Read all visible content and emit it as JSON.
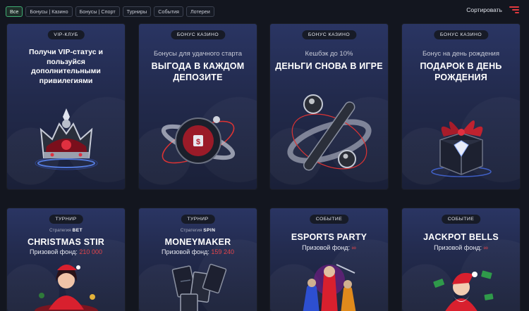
{
  "filters": [
    "Все",
    "Бонусы | Казино",
    "Бонусы | Спорт",
    "Турниры",
    "События",
    "Лотереи"
  ],
  "sort_label": "Сортировать",
  "cards": [
    {
      "badge": "VIP-КЛУБ",
      "title": "Получи VIP-статус и пользуйся дополнительными привилегиями",
      "icon": "crown-icon"
    },
    {
      "badge": "БОНУС КАЗИНО",
      "subtitle": "Бонусы для удачного старта",
      "title": "ВЫГОДА В КАЖДОМ ДЕПОЗИТЕ",
      "icon": "deposit-sphere-icon"
    },
    {
      "badge": "БОНУС КАЗИНО",
      "subtitle": "Кешбэк до 10%",
      "title": "ДЕНЬГИ СНОВА В ИГРЕ",
      "icon": "cashback-icon"
    },
    {
      "badge": "БОНУС КАЗИНО",
      "subtitle": "Бонус на день рождения",
      "title": "ПОДАРОК В ДЕНЬ РОЖДЕНИЯ",
      "icon": "gift-box-icon"
    },
    {
      "badge": "ТУРНИР",
      "strategy_label": "Стратегия",
      "strategy_value": "BET",
      "title": "CHRISTMAS STIR",
      "prize_label": "Призовой фонд:",
      "prize_value": "210 000",
      "icon": "christmas-girl-icon"
    },
    {
      "badge": "ТУРНИР",
      "strategy_label": "Стратегия",
      "strategy_value": "SPIN",
      "title": "MONEYMAKER",
      "prize_label": "Призовой фонд:",
      "prize_value": "159 240",
      "icon": "money-cards-icon"
    },
    {
      "badge": "СОБЫТИЕ",
      "title": "ESPORTS PARTY",
      "prize_label": "Призовой фонд:",
      "prize_value": "∞",
      "icon": "esports-heroes-icon"
    },
    {
      "badge": "СОБЫТИЕ",
      "title": "JACKPOT BELLS",
      "prize_label": "Призовой фонд:",
      "prize_value": "∞",
      "icon": "santa-icon"
    }
  ],
  "colors": {
    "accent_red": "#e2454b",
    "active_chip": "#3fae74",
    "card_top": "#2a3563",
    "page_bg": "#13161f"
  }
}
